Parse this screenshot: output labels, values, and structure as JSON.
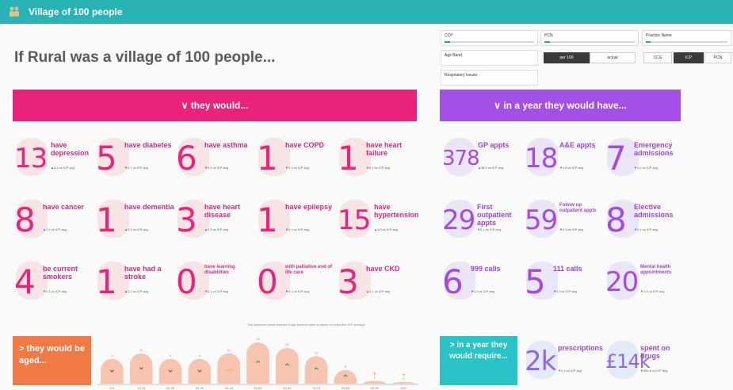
{
  "app": {
    "title": "Village of 100 people"
  },
  "headline": "If Rural was a village of 100 people...",
  "filters": {
    "ccp": {
      "label": "CCP"
    },
    "pcn": {
      "label": "PCN"
    },
    "practice": {
      "label": "Practice Name"
    },
    "age_band": {
      "label": "Age Band"
    },
    "respiratory": {
      "label": "Respiratory Issues"
    },
    "mode_options": [
      {
        "label": "per 100",
        "selected": true
      },
      {
        "label": "actual",
        "selected": false
      }
    ],
    "compare_options": [
      {
        "label": "CCG",
        "selected": false
      },
      {
        "label": "ICP",
        "selected": true
      },
      {
        "label": "PCN",
        "selected": false
      }
    ]
  },
  "left_banner": "∨ they would...",
  "right_banner": "∨ in a year they would have...",
  "conditions": [
    {
      "num": "13",
      "label": "have depression",
      "sub": "▲3.1 vs ICP avg",
      "color": "#e9237a"
    },
    {
      "num": "5",
      "label": "have diabetes",
      "sub": "▼0.7 vs ICP avg",
      "color": "#e9237a"
    },
    {
      "num": "6",
      "label": "have asthma",
      "sub": "▼0.3 vs ICP avg",
      "color": "#e9237a"
    },
    {
      "num": "1",
      "label": "have COPD",
      "sub": "▼0.1 vs ICP avg",
      "color": "#e9237a"
    },
    {
      "num": "1",
      "label": "have heart failure",
      "sub": "▼0.1 vs ICP avg",
      "color": "#e9237a"
    },
    {
      "num": "8",
      "label": "have cancer",
      "sub": "▲1.0 vs ICP avg",
      "color": "#e9237a"
    },
    {
      "num": "1",
      "label": "have dementia",
      "sub": "▲0.3 vs ICP avg",
      "color": "#e9237a"
    },
    {
      "num": "3",
      "label": "have heart disease",
      "sub": "▲0.3 vs ICP avg",
      "color": "#e9237a"
    },
    {
      "num": "1",
      "label": "have epilepsy",
      "sub": "▼0.1 vs ICP avg",
      "color": "#e9237a"
    },
    {
      "num": "15",
      "label": "have hypertension",
      "sub": "▲1.0 vs ICP avg",
      "color": "#e9237a"
    },
    {
      "num": "4",
      "label": "be current smokers",
      "sub": "▼1.2 vs ICP avg",
      "color": "#e9237a"
    },
    {
      "num": "1",
      "label": "have had a stroke",
      "sub": "▲0.1 vs ICP avg",
      "color": "#e9237a"
    },
    {
      "num": "0",
      "label": "have learning disabilities",
      "sub": "▼0.1 vs ICP avg",
      "color": "#e9237a"
    },
    {
      "num": "0",
      "label": "with palliative end of life care",
      "sub": "▼0.1 vs ICP avg",
      "color": "#e9237a"
    },
    {
      "num": "3",
      "label": "have CKD",
      "sub": "▲0.1 vs ICP avg",
      "color": "#e9237a"
    }
  ],
  "activity": [
    {
      "num": "378",
      "label": "GP appts",
      "sub": "▲38.9 vs ICP avg"
    },
    {
      "num": "18",
      "label": "A&E appts",
      "sub": "▼1.8 vs ICP avg"
    },
    {
      "num": "7",
      "label": "Emergency admissions",
      "sub": "▼1.0 vs ICP avg"
    },
    {
      "num": "29",
      "label": "First outpatient appts",
      "sub": "▼0.1 vs ICP avg"
    },
    {
      "num": "59",
      "label": "Follow up outpatient appts",
      "sub": "▼4.3 vs ICP avg"
    },
    {
      "num": "8",
      "label": "Elective admissions",
      "sub": "▼0.1 vs ICP avg"
    },
    {
      "num": "6",
      "label": "999 calls",
      "sub": "▼1.0 vs ICP avg"
    },
    {
      "num": "5",
      "label": "111 calls",
      "sub": "▼0.3 vs ICP avg"
    },
    {
      "num": "20",
      "label": "Mental health appointments",
      "sub": "▼1.3 vs ICP avg"
    }
  ],
  "note": "The chevrons below indicate if age bracket value is above or below the ICP average",
  "aged_label": "> they would be aged...",
  "age_groups": [
    {
      "band": "0-9",
      "value": 9,
      "trend": "down"
    },
    {
      "band": "10-19",
      "value": 11,
      "trend": "down"
    },
    {
      "band": "20-29",
      "value": 9,
      "trend": "down"
    },
    {
      "band": "30-39",
      "value": 9,
      "trend": "down"
    },
    {
      "band": "40-49",
      "value": 11,
      "trend": "neutral"
    },
    {
      "band": "50-59",
      "value": 15,
      "trend": "up"
    },
    {
      "band": "60-69",
      "value": 13,
      "trend": "up"
    },
    {
      "band": "70-79",
      "value": 10,
      "trend": "up"
    },
    {
      "band": "80-89",
      "value": 5,
      "trend": "up"
    },
    {
      "band": "90-99",
      "value": 1,
      "trend": "neutral"
    },
    {
      "band": "100+",
      "value": 0,
      "trend": "neutral"
    }
  ],
  "require_label": "> in a year they would require...",
  "requirements": [
    {
      "num": "2k",
      "label": "prescriptions",
      "sub": "▼0.1 vs ICP avg"
    },
    {
      "num": "£14k",
      "label": "spent on drugs",
      "sub": "▼383.6 vs ICP avg"
    }
  ],
  "colors": {
    "topbar": "#2ab3b5",
    "pink": "#e9237a",
    "purple": "#a350e6",
    "orange": "#ef7a45",
    "teal": "#2bc4c6"
  }
}
